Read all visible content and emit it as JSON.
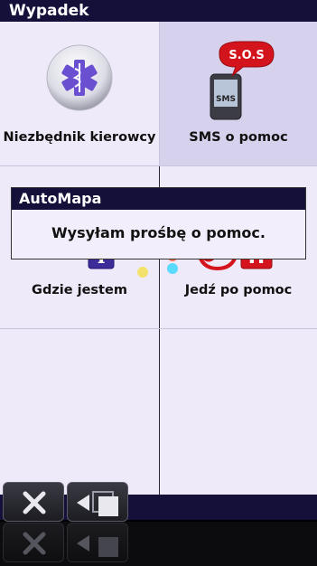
{
  "window": {
    "title": "Wypadek"
  },
  "grid": {
    "items": [
      {
        "label": "Niezbędnik kierowcy",
        "icon": "medical-star-icon"
      },
      {
        "label": "SMS o pomoc",
        "icon": "sms-sos-icon"
      },
      {
        "label": "Gdzie jestem",
        "icon": "location-info-icon"
      },
      {
        "label": "Jedź po pomoc",
        "icon": "hospital-stethoscope-icon"
      }
    ],
    "sos_text": "S.O.S",
    "sms_text": "SMS",
    "info_glyph": "i",
    "hospital_glyph": "H"
  },
  "dialog": {
    "title": "AutoMapa",
    "message": "Wysyłam prośbę o pomoc."
  },
  "toolbar": {
    "close_icon": "close-icon",
    "back_icon": "back-icon"
  },
  "colors": {
    "title_bar": "#14103a",
    "background": "#efeaf9",
    "highlight": "#d6d1ec",
    "sos_red": "#d4141c"
  }
}
